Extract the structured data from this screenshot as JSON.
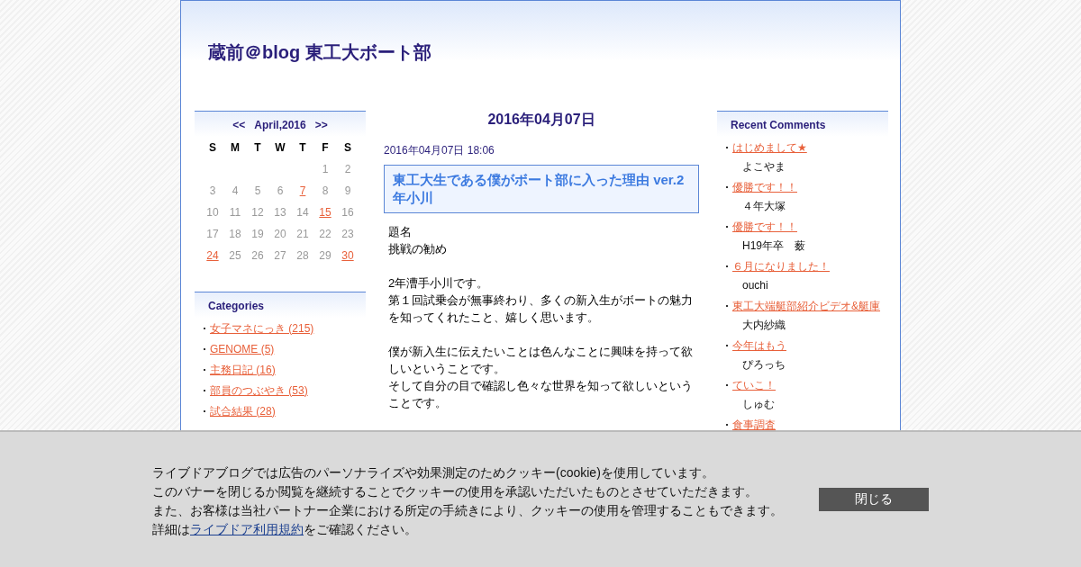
{
  "blog_title": "蔵前＠blog 東工大ボート部",
  "calendar": {
    "prev": "<<",
    "month": "April,2016",
    "next": ">>",
    "weekdays": [
      "S",
      "M",
      "T",
      "W",
      "T",
      "F",
      "S"
    ],
    "weeks": [
      [
        {
          "day": "1",
          "linked": false
        },
        {
          "day": "2",
          "linked": false
        }
      ],
      [
        {
          "day": "3",
          "linked": false
        },
        {
          "day": "4",
          "linked": false
        },
        {
          "day": "5",
          "linked": false
        },
        {
          "day": "6",
          "linked": false
        },
        {
          "day": "7",
          "linked": true
        },
        {
          "day": "8",
          "linked": false
        },
        {
          "day": "9",
          "linked": false
        }
      ],
      [
        {
          "day": "10",
          "linked": false
        },
        {
          "day": "11",
          "linked": false
        },
        {
          "day": "12",
          "linked": false
        },
        {
          "day": "13",
          "linked": false
        },
        {
          "day": "14",
          "linked": false
        },
        {
          "day": "15",
          "linked": true
        },
        {
          "day": "16",
          "linked": false
        }
      ],
      [
        {
          "day": "17",
          "linked": false
        },
        {
          "day": "18",
          "linked": false
        },
        {
          "day": "19",
          "linked": false
        },
        {
          "day": "20",
          "linked": false
        },
        {
          "day": "21",
          "linked": false
        },
        {
          "day": "22",
          "linked": false
        },
        {
          "day": "23",
          "linked": false
        }
      ],
      [
        {
          "day": "24",
          "linked": true
        },
        {
          "day": "25",
          "linked": false
        },
        {
          "day": "26",
          "linked": false
        },
        {
          "day": "27",
          "linked": false
        },
        {
          "day": "28",
          "linked": false
        },
        {
          "day": "29",
          "linked": false
        },
        {
          "day": "30",
          "linked": true
        }
      ]
    ]
  },
  "categories": {
    "title": "Categories",
    "items": [
      "女子マネにっき (215)",
      "GENOME (5)",
      "主務日記 (16)",
      "部員のつぶやき (53)",
      "試合結果 (28)"
    ]
  },
  "date_heading": "2016年04月07日",
  "post": {
    "timestamp": "2016年04月07日 18:06",
    "title": "東工大生である僕がボート部に入った理由 ver.2年小川",
    "paragraphs": [
      [
        "題名",
        "挑戦の勧め"
      ],
      [
        "2年漕手小川です。",
        "第１回試乗会が無事終わり、多くの新入生がボートの魅力を知ってくれたこと、嬉しく思います。"
      ],
      [
        "僕が新入生に伝えたいことは色んなことに興味を持って欲しいということです。",
        "そして自分の目で確認し色々な世界を知って欲しいということです。"
      ]
    ]
  },
  "recent_comments": {
    "title": "Recent Comments",
    "items": [
      {
        "entry": "はじめまして★",
        "author": "よこやま"
      },
      {
        "entry": "優勝です！！",
        "author": "４年大塚"
      },
      {
        "entry": "優勝です！！",
        "author": "H19年卒　薮"
      },
      {
        "entry": "６月になりました！",
        "author": "ouchi"
      },
      {
        "entry": "東工大端艇部紹介ビデオ&艇庫",
        "author": "大内紗織"
      },
      {
        "entry": "今年はもう",
        "author": "ぴろっち"
      },
      {
        "entry": "ていこ！",
        "author": "しゅむ"
      },
      {
        "entry": "食事調査"
      }
    ]
  },
  "cookie_banner": {
    "lines": [
      "ライブドアブログでは広告のパーソナライズや効果測定のためクッキー(cookie)を使用しています。",
      "このバナーを閉じるか閲覧を継続することでクッキーの使用を承認いただいたものとさせていただきます。",
      "また、お客様は当社パートナー企業における所定の手続きにより、クッキーの使用を管理することもできます。"
    ],
    "last_line": {
      "before": "詳細は",
      "link": "ライブドア利用規約",
      "after": "をご確認ください。"
    },
    "close_button": "閉じる"
  }
}
